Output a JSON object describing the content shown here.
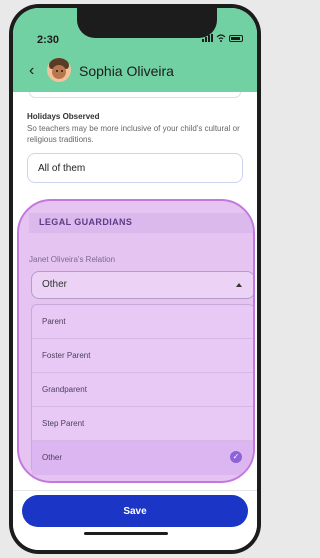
{
  "status": {
    "time": "2:30"
  },
  "header": {
    "title": "Sophia Oliveira"
  },
  "holidays": {
    "label": "Holidays Observed",
    "help": "So teachers may be more inclusive of your child's cultural or religious traditions.",
    "value": "All of them"
  },
  "guardians": {
    "heading": "LEGAL GUARDIANS",
    "relation_label": "Janet Oliveira's Relation",
    "selected": "Other",
    "options": [
      "Parent",
      "Foster Parent",
      "Grandparent",
      "Step Parent",
      "Other"
    ]
  },
  "actions": {
    "save_label": "Save"
  },
  "colors": {
    "header": "#72d1a3",
    "accent": "#1b36c7",
    "highlight": "#c577e0"
  },
  "icons": {
    "back": "chevron-left-icon",
    "check": "check-circle-icon"
  }
}
